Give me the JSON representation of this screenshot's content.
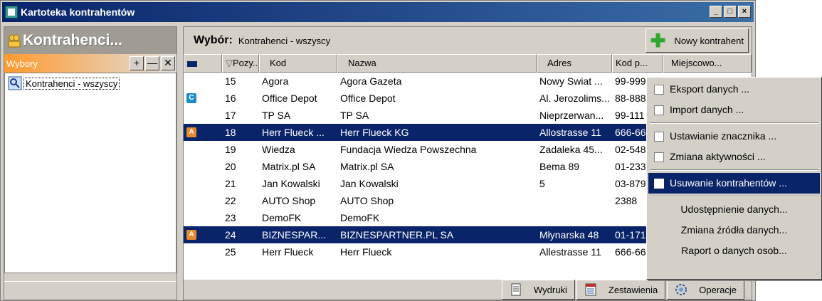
{
  "window": {
    "title": "Kartoteka kontrahentów"
  },
  "left_panel": {
    "heading": "Kontrahenci...",
    "wybory_label": "Wybory",
    "btn_add": "+",
    "btn_remove": "—",
    "btn_close": "✕",
    "tree": [
      {
        "label": "Kontrahenci - wszyscy"
      }
    ]
  },
  "right_panel": {
    "title_bold": "Wybór:",
    "title_value": "Kontrahenci - wszyscy",
    "new_button": "Nowy kontrahent",
    "columns": [
      "Pozy...",
      "Kod",
      "Nazwa",
      "Adres",
      "Kod p...",
      "Miejscowo..."
    ],
    "rows": [
      {
        "badge": "",
        "poz": "15",
        "kod": "Agora",
        "nazwa": "Agora Gazeta",
        "adres": "Nowy Swiat ...",
        "zip": "99-999",
        "miasto": "",
        "selected": false
      },
      {
        "badge": "C",
        "poz": "16",
        "kod": "Office Depot",
        "nazwa": "Office Depot",
        "adres": "Al. Jerozolims...",
        "zip": "88-888",
        "miasto": "",
        "selected": false
      },
      {
        "badge": "",
        "poz": "17",
        "kod": "TP SA",
        "nazwa": "TP SA",
        "adres": "Nieprzerwan...",
        "zip": "99-111",
        "miasto": "",
        "selected": false
      },
      {
        "badge": "A",
        "poz": "18",
        "kod": "Herr Flueck ...",
        "nazwa": "Herr Flueck KG",
        "adres": "Allostrasse 11",
        "zip": "666-66",
        "miasto": "",
        "selected": true
      },
      {
        "badge": "",
        "poz": "19",
        "kod": "Wiedza",
        "nazwa": "Fundacja Wiedza Powszechna",
        "adres": "Zadaleka 45...",
        "zip": "02-548",
        "miasto": "",
        "selected": false
      },
      {
        "badge": "",
        "poz": "20",
        "kod": "Matrix.pl SA",
        "nazwa": "Matrix.pl SA",
        "adres": "Bema 89",
        "zip": "01-233",
        "miasto": "",
        "selected": false
      },
      {
        "badge": "",
        "poz": "21",
        "kod": "Jan Kowalski",
        "nazwa": "Jan Kowalski",
        "adres": " 5",
        "zip": "03-879",
        "miasto": "",
        "selected": false
      },
      {
        "badge": "",
        "poz": "22",
        "kod": "AUTO Shop",
        "nazwa": "AUTO Shop",
        "adres": "",
        "zip": "2388",
        "miasto": "",
        "selected": false
      },
      {
        "badge": "",
        "poz": "23",
        "kod": "DemoFK",
        "nazwa": "DemoFK",
        "adres": "",
        "zip": "",
        "miasto": "",
        "selected": false
      },
      {
        "badge": "A",
        "poz": "24",
        "kod": "BIZNESPAR...",
        "nazwa": "BIZNESPARTNER.PL SA",
        "adres": "Młynarska 48",
        "zip": "01-171",
        "miasto": "",
        "selected": true
      },
      {
        "badge": "",
        "poz": "25",
        "kod": "Herr Flueck",
        "nazwa": "Herr Flueck",
        "adres": "Allestrasse 11",
        "zip": "666-66",
        "miasto": "",
        "selected": false
      }
    ],
    "footer_buttons": [
      "Wydruki",
      "Zestawienia",
      "Operacje"
    ]
  },
  "context_menu": {
    "items": [
      {
        "label": "Eksport danych ...",
        "check": true,
        "highlight": false
      },
      {
        "label": "Import danych ...",
        "check": true,
        "highlight": false
      },
      {
        "sep": true
      },
      {
        "label": "Ustawianie znacznika ...",
        "check": true,
        "highlight": false
      },
      {
        "label": "Zmiana aktywności ...",
        "check": true,
        "highlight": false
      },
      {
        "sep": true
      },
      {
        "label": "Usuwanie kontrahentów ...",
        "check": true,
        "highlight": true
      },
      {
        "sep": true
      },
      {
        "label": "Udostępnienie danych...",
        "check": false,
        "highlight": false
      },
      {
        "label": "Zmiana źródła danych...",
        "check": false,
        "highlight": false
      },
      {
        "label": "Raport o danych osob...",
        "check": false,
        "highlight": false
      }
    ]
  }
}
